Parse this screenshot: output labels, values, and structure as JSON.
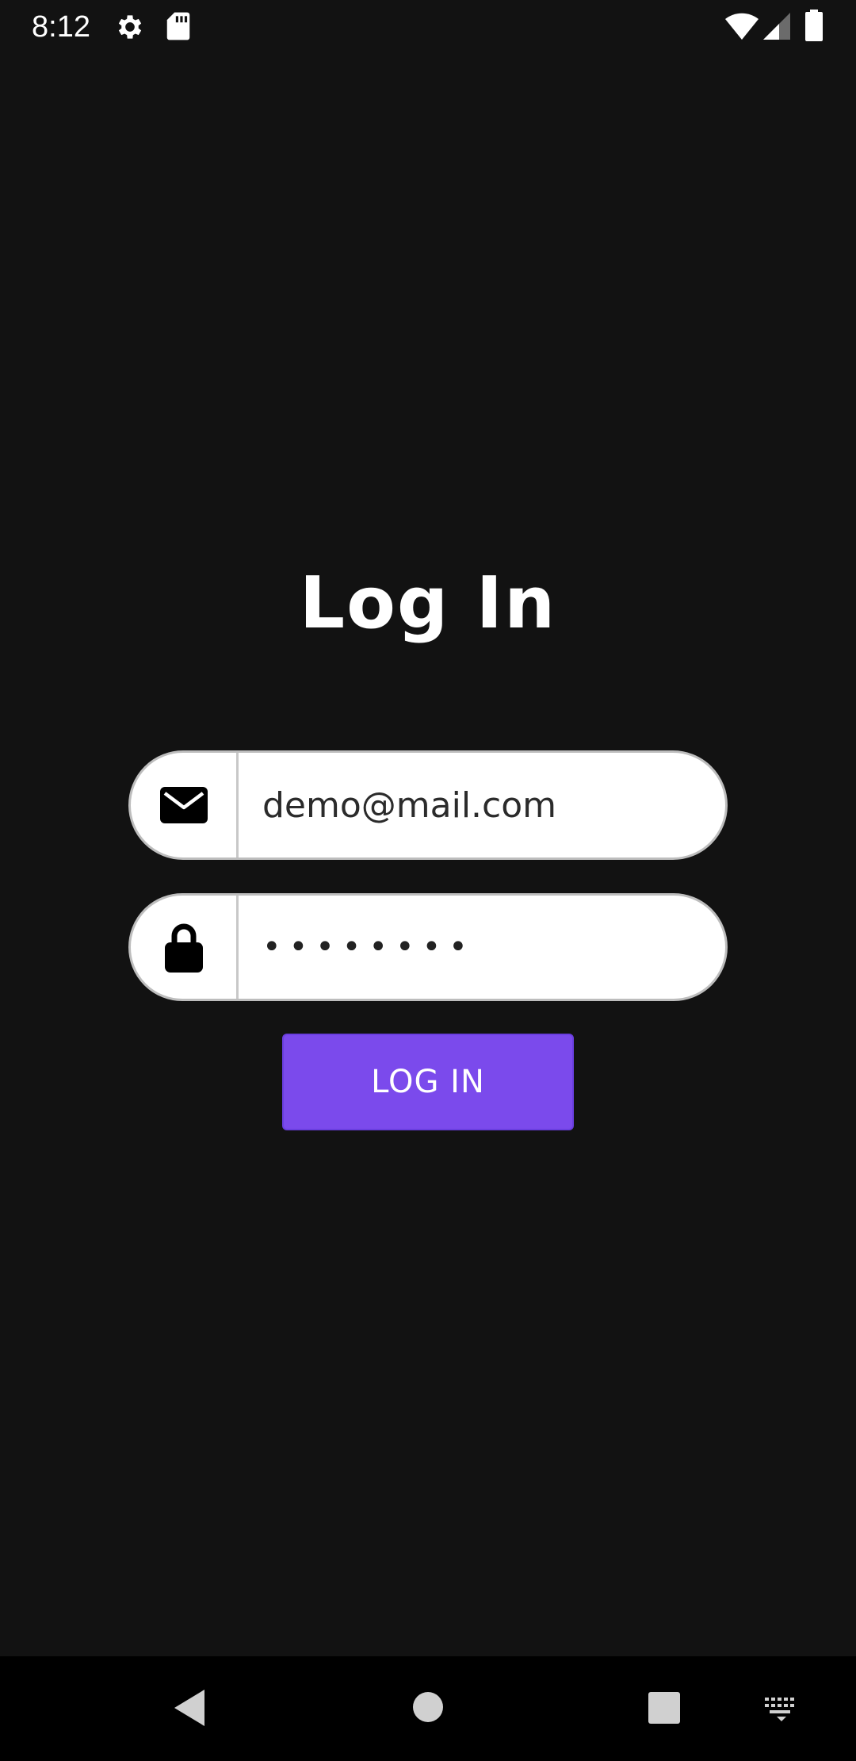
{
  "status_bar": {
    "time": "8:12",
    "icons": [
      "gear-icon",
      "sd-card-icon",
      "wifi-icon",
      "signal-icon",
      "battery-icon"
    ]
  },
  "login": {
    "title": "Log In",
    "email": {
      "value": "demo@mail.com",
      "icon": "envelope-icon"
    },
    "password": {
      "masked_value": "••••••••",
      "icon": "lock-icon"
    },
    "button_label": "LOG IN"
  },
  "nav_bar": {
    "icons": [
      "back-icon",
      "home-icon",
      "recents-icon",
      "keyboard-icon"
    ]
  },
  "colors": {
    "background": "#121212",
    "accent": "#7b4aec",
    "field_background": "#ffffff",
    "field_border": "#bdbdbd",
    "text_primary": "#ffffff"
  }
}
